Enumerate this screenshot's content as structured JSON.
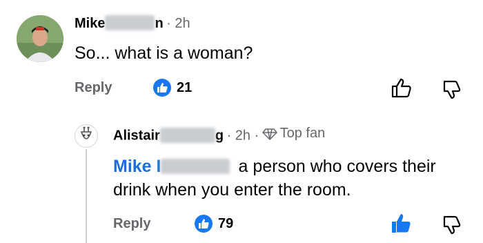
{
  "comment1": {
    "author_visible_start": "Mike",
    "author_visible_end": "n",
    "time": "· 2h",
    "text": "So... what is a woman?",
    "reply_label": "Reply",
    "like_count": "21"
  },
  "comment2": {
    "author_visible_start": "Alistair",
    "author_visible_end": "g",
    "time": "· 2h ·",
    "badge": "Top fan",
    "mention_visible": "Mike I",
    "text_line1": "a person who covers their",
    "text_line2": "drink when you enter the room.",
    "reply_label": "Reply",
    "like_count": "79"
  },
  "colors": {
    "accent": "#1877f2",
    "mention": "#1a6ed8",
    "muted": "#65676b",
    "blur": "#c9ccd1"
  }
}
